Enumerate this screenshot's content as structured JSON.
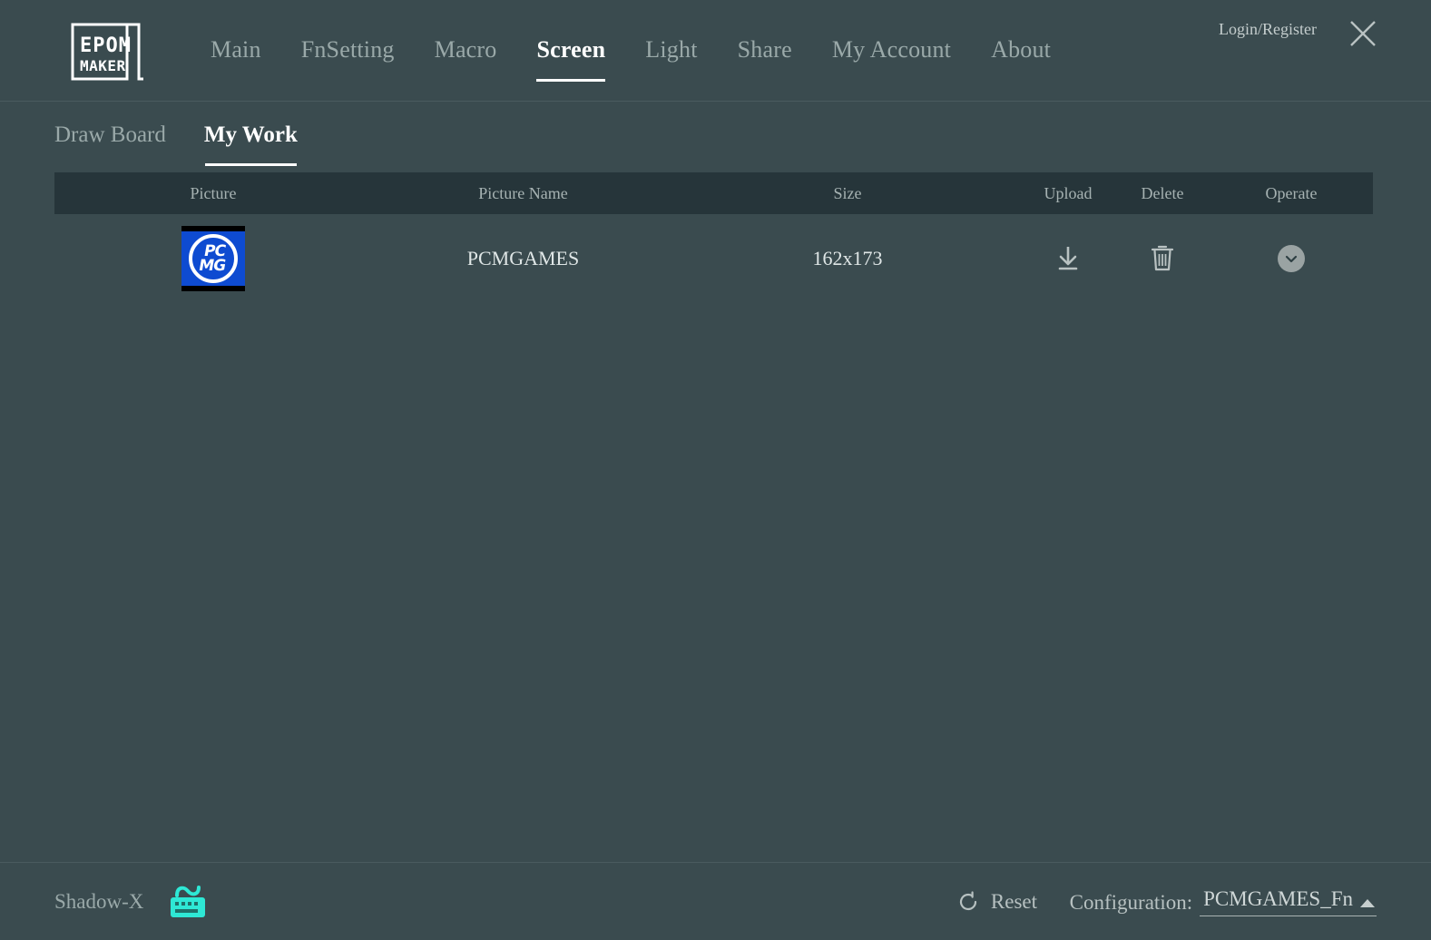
{
  "window": {
    "login_label": "Login/Register",
    "close_icon": "close-icon"
  },
  "brand": {
    "line1": "EPOM",
    "line2": "MAKER"
  },
  "nav": {
    "items": [
      {
        "label": "Main",
        "active": false
      },
      {
        "label": "FnSetting",
        "active": false
      },
      {
        "label": "Macro",
        "active": false
      },
      {
        "label": "Screen",
        "active": true
      },
      {
        "label": "Light",
        "active": false
      },
      {
        "label": "Share",
        "active": false
      },
      {
        "label": "My Account",
        "active": false
      },
      {
        "label": "About",
        "active": false
      }
    ]
  },
  "subtabs": {
    "items": [
      {
        "label": "Draw Board",
        "active": false
      },
      {
        "label": "My Work",
        "active": true
      }
    ]
  },
  "table": {
    "headers": {
      "picture": "Picture",
      "picture_name": "Picture Name",
      "size": "Size",
      "upload": "Upload",
      "delete": "Delete",
      "operate": "Operate"
    },
    "rows": [
      {
        "thumbnail_alt": "PCMG",
        "thumbnail_top": "PC",
        "thumbnail_bottom": "MG",
        "picture_name": "PCMGAMES",
        "size": "162x173",
        "upload_icon": "download-icon",
        "delete_icon": "trash-icon",
        "operate_icon": "chevron-down-icon"
      }
    ]
  },
  "footer": {
    "device_name": "Shadow-X",
    "keyboard_icon": "keyboard-icon",
    "reset_label": "Reset",
    "reset_icon": "refresh-icon",
    "configuration_label": "Configuration:",
    "configuration_value": "PCMGAMES_Fn",
    "configuration_caret": "caret-up-icon"
  },
  "colors": {
    "background": "#3a4b4f",
    "table_header_bg": "#26353a",
    "accent_cyan": "#2ee8d5",
    "thumb_blue": "#0e4bd1",
    "active_text": "#ffffff",
    "muted_text": "#9aa9a9"
  }
}
